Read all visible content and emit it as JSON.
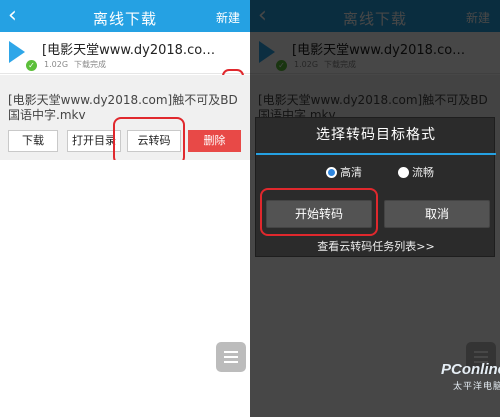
{
  "header": {
    "title": "离线下载",
    "new_label": "新建"
  },
  "download_item": {
    "title": "[电影天堂www.dy2018.com...",
    "size": "1.02G",
    "status": "下载完成",
    "full_filename": "[电影天堂www.dy2018.com]触不可及BD国语中字.mkv"
  },
  "actions": {
    "download": "下载",
    "open_folder": "打开目录",
    "cloud_transcode": "云转码",
    "delete": "删除"
  },
  "dialog": {
    "title": "选择转码目标格式",
    "options": [
      {
        "label": "高清",
        "selected": true
      },
      {
        "label": "流畅",
        "selected": false
      }
    ],
    "start_button": "开始转码",
    "cancel_button": "取消",
    "queue_link": "查看云转码任务列表>>"
  },
  "watermark": {
    "brand": "PConline",
    "sub": "太平洋电脑网"
  },
  "icons": {
    "back": "back-icon",
    "play": "play-icon",
    "check": "check-icon",
    "collapse": "chevron-up-icon",
    "menu": "menu-icon"
  },
  "colors": {
    "accent": "#25a1e3",
    "delete": "#e84947",
    "highlight": "#e0282d",
    "success": "#5cbf3a"
  }
}
